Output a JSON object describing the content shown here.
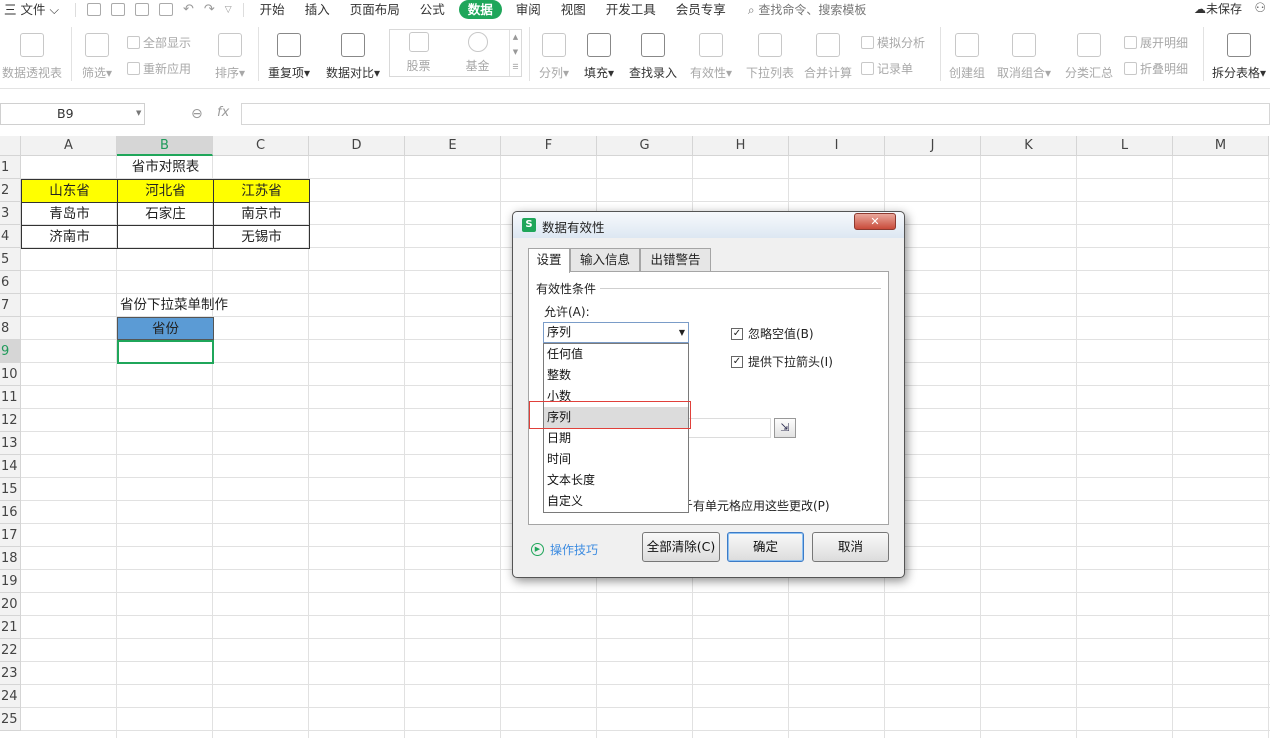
{
  "menubar": {
    "file": "三 文件 ⌵",
    "items": [
      "开始",
      "插入",
      "页面布局",
      "公式",
      "数据",
      "审阅",
      "视图",
      "开发工具",
      "会员专享"
    ],
    "active": "数据",
    "search": "查找命令、搜索模板",
    "unsaved": "未保存"
  },
  "ribbon": {
    "pivot": "数据透视表",
    "filter": "筛选",
    "show_all": "全部显示",
    "reapply": "重新应用",
    "sort": "排序",
    "duplicates": "重复项",
    "compare": "数据对比",
    "stocks": "股票",
    "funds": "基金",
    "split": "分列",
    "fill": "填充",
    "find_entry": "查找录入",
    "validity": "有效性",
    "dropdown_list": "下拉列表",
    "consolidate": "合并计算",
    "what_if": "模拟分析",
    "record_sheet": "记录单",
    "create_group": "创建组",
    "ungroup": "取消组合",
    "subtotal": "分类汇总",
    "expand_detail": "展开明细",
    "collapse_detail": "折叠明细",
    "split_table": "拆分表格"
  },
  "formula_bar": {
    "name_box": "B9",
    "fx": "fx",
    "value": ""
  },
  "grid": {
    "columns": [
      "A",
      "B",
      "C",
      "D",
      "E",
      "F",
      "G",
      "H",
      "I",
      "J",
      "K",
      "L",
      "M"
    ],
    "selected_column": "B",
    "rows": [
      "1",
      "2",
      "3",
      "4",
      "5",
      "6",
      "7",
      "8",
      "9",
      "10",
      "11",
      "12",
      "13",
      "14",
      "15",
      "16",
      "17",
      "18",
      "19",
      "20",
      "21",
      "22",
      "23",
      "24",
      "25"
    ],
    "selected_row": "9",
    "cells": {
      "title": "省市对照表",
      "A2": "山东省",
      "B2": "河北省",
      "C2": "江苏省",
      "A3": "青岛市",
      "B3": "石家庄",
      "C3": "南京市",
      "A4": "济南市",
      "B4": "",
      "C4": "无锡市",
      "B7": "省份下拉菜单制作",
      "B8": "省份",
      "B9": ""
    },
    "header_fill_yellow": "#ffff00",
    "header_fill_blue": "#5b9bd5",
    "selection_color": "#1fa65a"
  },
  "dialog": {
    "title": "数据有效性",
    "close": "✕",
    "tabs": [
      "设置",
      "输入信息",
      "出错警告"
    ],
    "active_tab": "设置",
    "criteria_group": "有效性条件",
    "allow_label": "允许(A):",
    "allow_value": "序列",
    "ignore_blank": "忽略空值(B)",
    "ignore_blank_checked": true,
    "in_cell_dropdown": "提供下拉箭头(I)",
    "in_cell_dropdown_checked": true,
    "options": [
      "任何值",
      "整数",
      "小数",
      "序列",
      "日期",
      "时间",
      "文本长度",
      "自定义"
    ],
    "highlighted_option": "序列",
    "apply_all_partial": "斤有单元格应用这些更改(P)",
    "tips": "操作技巧",
    "clear_all": "全部清除(C)",
    "ok": "确定",
    "cancel": "取消",
    "highlight_color": "#e0403a"
  }
}
